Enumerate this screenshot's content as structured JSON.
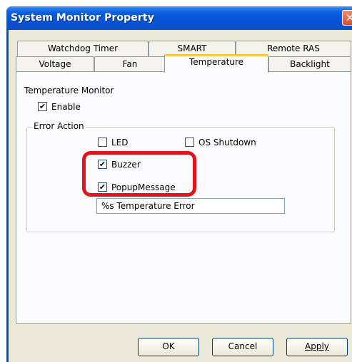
{
  "window": {
    "title": "System Monitor Property",
    "close_glyph": "✕"
  },
  "tabs": {
    "row1": [
      "Watchdog Timer",
      "SMART",
      "Remote RAS"
    ],
    "row2": [
      "Voltage",
      "Fan",
      "Temperature",
      "Backlight"
    ],
    "active": "Temperature"
  },
  "temperature_monitor": {
    "heading": "Temperature Monitor",
    "enable_label": "Enable",
    "enable_checked": true
  },
  "error_action": {
    "heading": "Error Action",
    "led_label": "LED",
    "led_checked": false,
    "os_shutdown_label": "OS Shutdown",
    "os_shutdown_checked": false,
    "buzzer_label": "Buzzer",
    "buzzer_checked": true,
    "popup_label": "PopupMessage",
    "popup_checked": true,
    "message_value": "%s Temperature Error"
  },
  "buttons": {
    "ok": "OK",
    "cancel": "Cancel",
    "apply": "Apply"
  },
  "colors": {
    "titlebar": "#0753d6",
    "highlight": "#e3131b",
    "active_tab_accent": "#ffc83c"
  },
  "icons": {
    "check": "✔"
  }
}
